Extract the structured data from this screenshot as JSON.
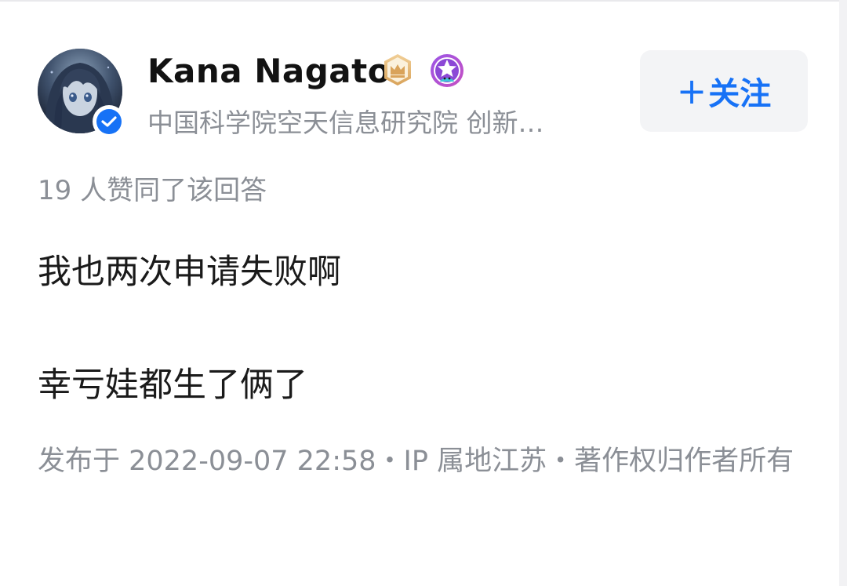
{
  "author": {
    "name": "Kana Nagato",
    "subtitle": "中国科学院空天信息研究院 创新…",
    "verified": true
  },
  "follow_button": {
    "plus": "+",
    "label": "关注"
  },
  "likes_text": "19 人赞同了该回答",
  "content": {
    "line1": "我也两次申请失败啊",
    "line2": "幸亏娃都生了俩了"
  },
  "meta_text": "发布于 2022-09-07 22:58・IP 属地江苏・著作权归作者所有",
  "colors": {
    "accent": "#1772f6",
    "secondary_text": "#8b8f96",
    "primary_text": "#121212",
    "button_bg": "#f3f4f6"
  },
  "icons": {
    "avatar": "anime-character-avatar",
    "verified": "verified-check-icon",
    "badge1": "crown-badge-icon",
    "badge2": "star-badge-icon"
  }
}
